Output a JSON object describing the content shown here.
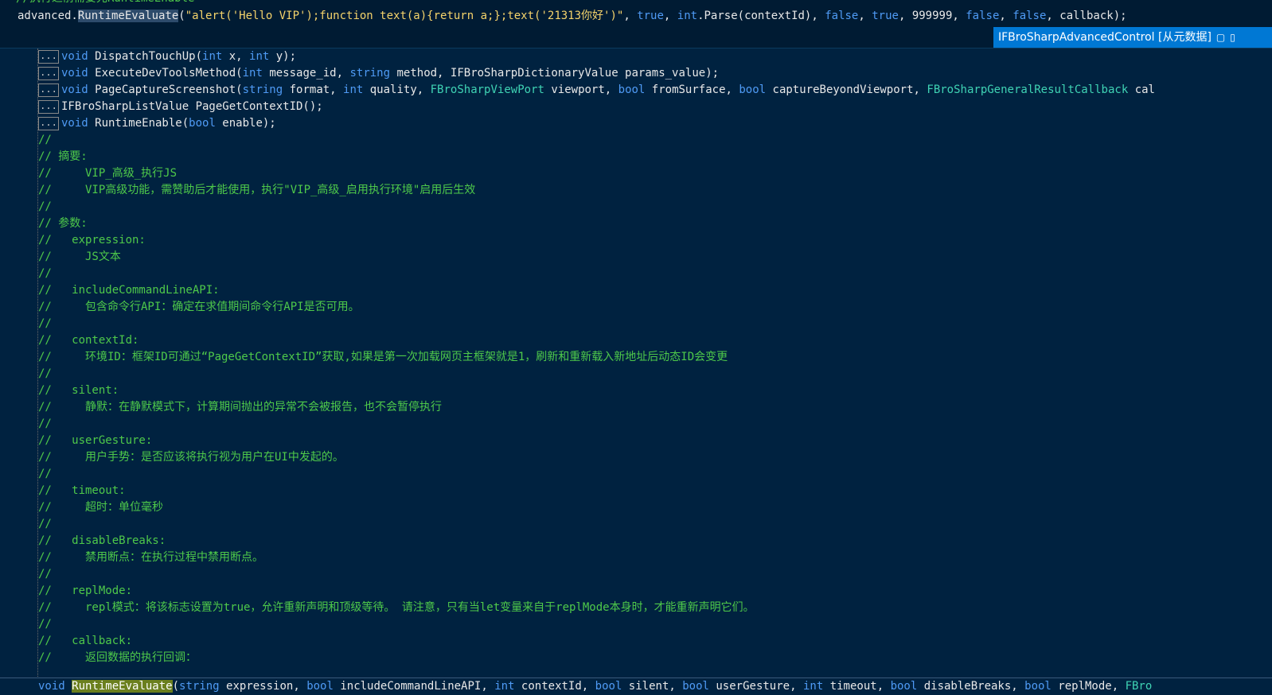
{
  "top": {
    "partial_comment": "//执行之前需要先RuntimeEnable",
    "call_prefix": "advanced.",
    "call_method": "RuntimeEvaluate",
    "call_open": "(",
    "call_string": "\"alert('Hello VIP');function text(a){return a;};text('21313你好')\"",
    "sep": ", ",
    "kw_true1": "true",
    "int_kw": "int",
    "parse_call": ".Parse(contextId)",
    "kw_false1": "false",
    "kw_true2": "true",
    "num_timeout": "999999",
    "kw_false2": "false",
    "kw_false3": "false",
    "callback": "callback",
    "call_close": ");"
  },
  "tooltip": {
    "text": "IFBroSharpAdvancedControl [从元数据]",
    "pin_icon": "pin-icon",
    "folder_icon": "folder-icon"
  },
  "editor": {
    "collapsed_label": "...",
    "collapsed_lines": [
      {
        "kw": "void",
        "rest": " DispatchTouchUp(",
        "p1t": "int",
        "p1": " x, ",
        "p2t": "int",
        "p2": " y);"
      },
      {
        "kw": "void",
        "rest": " ExecuteDevToolsMethod(",
        "p1t": "int",
        "p1": " message_id, ",
        "p2t": "string",
        "p2": " method, IFBroSharpDictionaryValue params_value);"
      },
      {
        "kw": "void",
        "rest": " PageCaptureScreenshot(",
        "p1t": "string",
        "p1": " format, ",
        "p2t": "int",
        "p2": " quality, "
      },
      {
        "kw": "",
        "rest": "IFBroSharpListValue PageGetContextID();",
        "p1t": "",
        "p1": "",
        "p2t": "",
        "p2": ""
      },
      {
        "kw": "void",
        "rest": " RuntimeEnable(",
        "p1t": "bool",
        "p1": " enable);",
        "p2t": "",
        "p2": ""
      }
    ],
    "capture_tail": {
      "t1": "FBroSharpViewPort",
      "a1": " viewport, ",
      "t2": "bool",
      "a2": " fromSurface, ",
      "t3": "bool",
      "a3": " captureBeyondViewport, ",
      "t4": "FBroSharpGeneralResultCallback",
      "a4": " cal"
    },
    "comments": [
      "//",
      "// 摘要:",
      "//     VIP_高级_执行JS",
      "//     VIP高级功能，需赞助后才能使用，执行\"VIP_高级_启用执行环境\"启用后生效",
      "//",
      "// 参数:",
      "//   expression:",
      "//     JS文本",
      "//",
      "//   includeCommandLineAPI:",
      "//     包含命令行API：确定在求值期间命令行API是否可用。",
      "//",
      "//   contextId:",
      "//     环境ID：框架ID可通过“PageGetContextID”获取,如果是第一次加载网页主框架就是1，刷新和重新载入新地址后动态ID会变更",
      "//",
      "//   silent:",
      "//     静默：在静默模式下，计算期间抛出的异常不会被报告，也不会暂停执行",
      "//",
      "//   userGesture:",
      "//     用户手势：是否应该将执行视为用户在UI中发起的。",
      "//",
      "//   timeout:",
      "//     超时：单位毫秒",
      "//",
      "//   disableBreaks:",
      "//     禁用断点：在执行过程中禁用断点。",
      "//",
      "//   replMode:",
      "//     repl模式：将该标志设置为true，允许重新声明和顶级等待。 请注意，只有当let变量来自于replMode本身时，才能重新声明它们。",
      "//",
      "//   callback:",
      "//     返回数据的执行回调："
    ],
    "signature": {
      "kw": "void",
      "space": " ",
      "name": "RuntimeEvaluate",
      "open": "(",
      "params": [
        {
          "t": "string",
          "n": " expression, "
        },
        {
          "t": "bool",
          "n": " includeCommandLineAPI, "
        },
        {
          "t": "int",
          "n": " contextId, "
        },
        {
          "t": "bool",
          "n": " silent, "
        },
        {
          "t": "bool",
          "n": " userGesture, "
        },
        {
          "t": "int",
          "n": " timeout, "
        },
        {
          "t": "bool",
          "n": " disableBreaks, "
        },
        {
          "t": "bool",
          "n": " replMode, "
        }
      ],
      "tail": "FBro"
    }
  }
}
